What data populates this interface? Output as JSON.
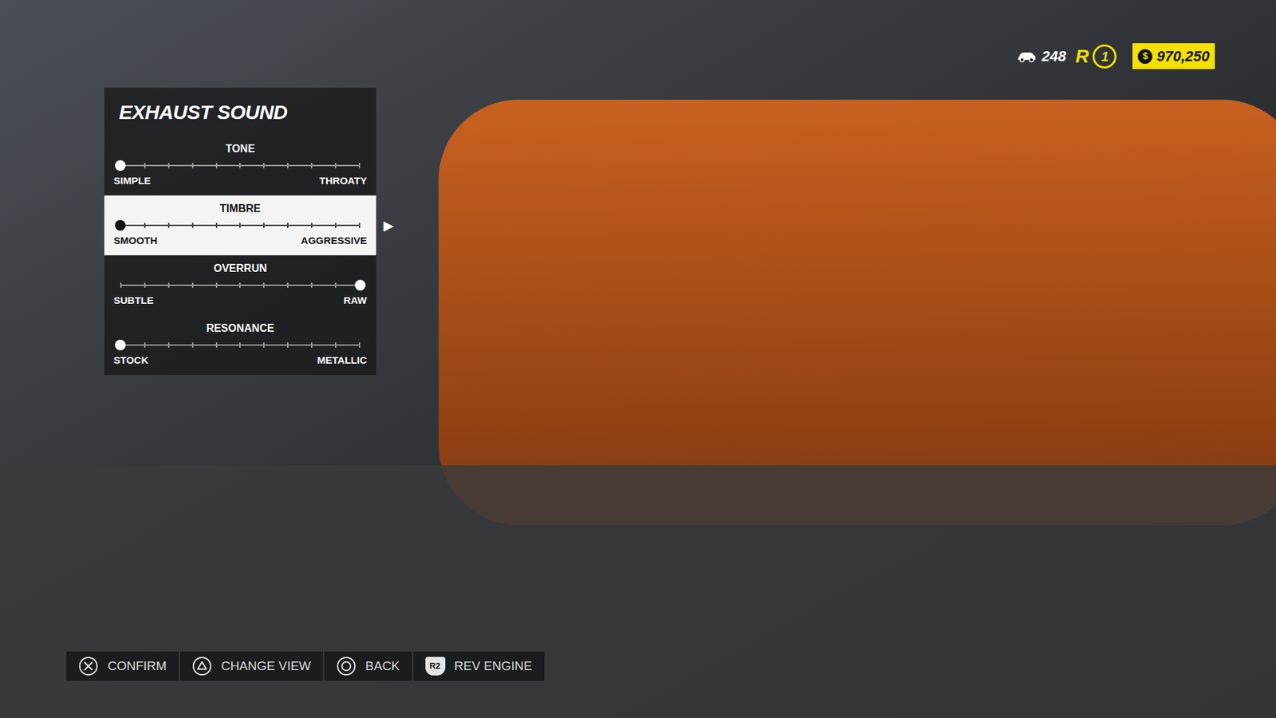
{
  "hud": {
    "cars": "248",
    "rep_logo": "R",
    "rep_level": "1",
    "currency": "$",
    "money": "970,250"
  },
  "panel": {
    "title": "EXHAUST SOUND",
    "selected_arrow": "▶",
    "sliders": [
      {
        "label": "TONE",
        "min_label": "SIMPLE",
        "max_label": "THROATY",
        "level": 0,
        "selected": false
      },
      {
        "label": "TIMBRE",
        "min_label": "SMOOTH",
        "max_label": "AGGRESSIVE",
        "level": 0,
        "selected": true
      },
      {
        "label": "OVERRUN",
        "min_label": "SUBTLE",
        "max_label": "RAW",
        "level": 1,
        "selected": false
      },
      {
        "label": "RESONANCE",
        "min_label": "STOCK",
        "max_label": "METALLIC",
        "level": 0,
        "selected": false
      }
    ]
  },
  "controls": [
    {
      "kind": "cross",
      "label": "CONFIRM"
    },
    {
      "kind": "triangle",
      "label": "CHANGE VIEW"
    },
    {
      "kind": "circle",
      "label": "BACK"
    },
    {
      "kind": "key",
      "key": "R2",
      "label": "REV ENGINE"
    }
  ]
}
